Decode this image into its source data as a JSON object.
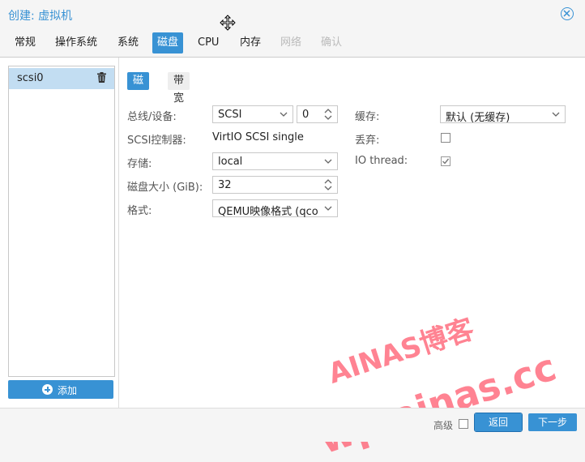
{
  "window": {
    "title": "创建: 虚拟机"
  },
  "tabs": [
    {
      "label": "常规",
      "state": "normal"
    },
    {
      "label": "操作系统",
      "state": "normal"
    },
    {
      "label": "系统",
      "state": "normal"
    },
    {
      "label": "磁盘",
      "state": "active"
    },
    {
      "label": "CPU",
      "state": "normal"
    },
    {
      "label": "内存",
      "state": "normal"
    },
    {
      "label": "网络",
      "state": "disabled"
    },
    {
      "label": "确认",
      "state": "disabled"
    }
  ],
  "disk_list": {
    "items": [
      {
        "label": "scsi0"
      }
    ],
    "add_label": "添加"
  },
  "subtabs": [
    {
      "label": "磁盘"
    },
    {
      "label": "带宽"
    }
  ],
  "form": {
    "bus_label": "总线/设备:",
    "bus_value": "SCSI",
    "device_value": "0",
    "controller_label": "SCSI控制器:",
    "controller_value": "VirtIO SCSI single",
    "storage_label": "存储:",
    "storage_value": "local",
    "size_label": "磁盘大小 (GiB):",
    "size_value": "32",
    "format_label": "格式:",
    "format_value": "QEMU映像格式 (qco",
    "cache_label": "缓存:",
    "cache_value": "默认 (无缓存)",
    "discard_label": "丢弃:",
    "discard_checked": false,
    "iothread_label": "IO thread:",
    "iothread_checked": true
  },
  "watermark": {
    "line1": "AINAS博客",
    "line2": "wp.ainas.cc"
  },
  "footer": {
    "advanced_label": "高级",
    "advanced_checked": false,
    "back_label": "返回",
    "next_label": "下一步"
  },
  "colors": {
    "accent": "#3892d4",
    "watermark": "#ff5a6e"
  }
}
